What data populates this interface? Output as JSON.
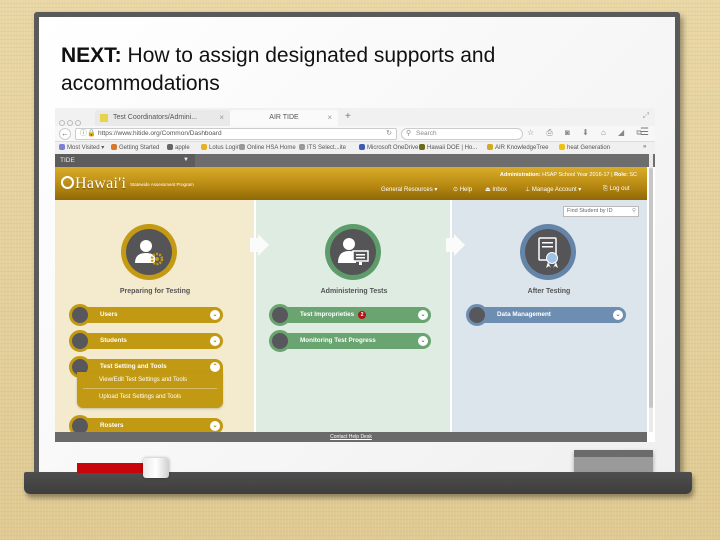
{
  "slide": {
    "title_bold": "NEXT:",
    "title_rest": " How to assign designated supports and accommodations"
  },
  "browser": {
    "tabs": [
      {
        "label": "Test Coordinators/Admini...",
        "active": false
      },
      {
        "label": "AIR TIDE",
        "active": true
      }
    ],
    "close_glyph": "×",
    "new_tab_glyph": "+",
    "url": "https://www.hitide.org/Common/Dashboard",
    "search_placeholder": "Search",
    "toolbar_icons": "☆ ⎙ ◙ ⬇ ⌂ ◢ ⧉",
    "bookmarks": [
      {
        "label": "Most Visited ▾",
        "color": "#7b7fd6"
      },
      {
        "label": "Getting Started",
        "color": "#d9772a"
      },
      {
        "label": "apple",
        "color": "#666666"
      },
      {
        "label": "Lotus Login",
        "color": "#e6b31e"
      },
      {
        "label": "Online HSA Home",
        "color": "#999999"
      },
      {
        "label": "ITS Select...ite",
        "color": "#999999"
      },
      {
        "label": "Microsoft OneDrive",
        "color": "#3e5bb5"
      },
      {
        "label": "Hawaii DOE | Ho...",
        "color": "#6b6b1a"
      },
      {
        "label": "AIR KnowledgeTree",
        "color": "#d4a820"
      },
      {
        "label": "heat Generation",
        "color": "#f0c010"
      }
    ],
    "bookmarks_overflow": "»"
  },
  "app": {
    "tide_label": "TIDE",
    "logo_text": "Hawai'i",
    "logo_sub": "Statewide Assessment Program",
    "admin_label": "Administration:",
    "admin_value": "HSAP School Year 2016-17",
    "role_label": "Role:",
    "role_value": "SC",
    "nav": [
      {
        "label": "General Resources ▾",
        "icon": "resources"
      },
      {
        "label": "Help",
        "icon": "help-icon"
      },
      {
        "label": "Inbox",
        "icon": "inbox-icon"
      },
      {
        "label": "Manage Account ▾",
        "icon": "user-icon"
      },
      {
        "label": "Log out",
        "icon": "logout-icon"
      }
    ],
    "find_student_placeholder": "Find Student by ID",
    "columns": [
      {
        "title": "Preparing for Testing",
        "color": "#c29913",
        "items": [
          {
            "label": "Users",
            "expanded": false
          },
          {
            "label": "Students",
            "expanded": false
          },
          {
            "label": "Test Setting and Tools",
            "expanded": true,
            "subitems": [
              "View/Edit Test Settings and Tools",
              "Upload Test Settings and Tools"
            ]
          },
          {
            "label": "Rosters",
            "expanded": false
          }
        ]
      },
      {
        "title": "Administering Tests",
        "color": "#69a471",
        "items": [
          {
            "label": "Test Improprieties",
            "badge": "2",
            "expanded": false
          },
          {
            "label": "Monitoring Test Progress",
            "expanded": false
          }
        ]
      },
      {
        "title": "After Testing",
        "color": "#6e8eb1",
        "items": [
          {
            "label": "Data Management",
            "expanded": false
          }
        ]
      }
    ],
    "chevron_down": "⌄",
    "chevron_up": "⌃",
    "footer_link": "Contact Help Desk"
  }
}
